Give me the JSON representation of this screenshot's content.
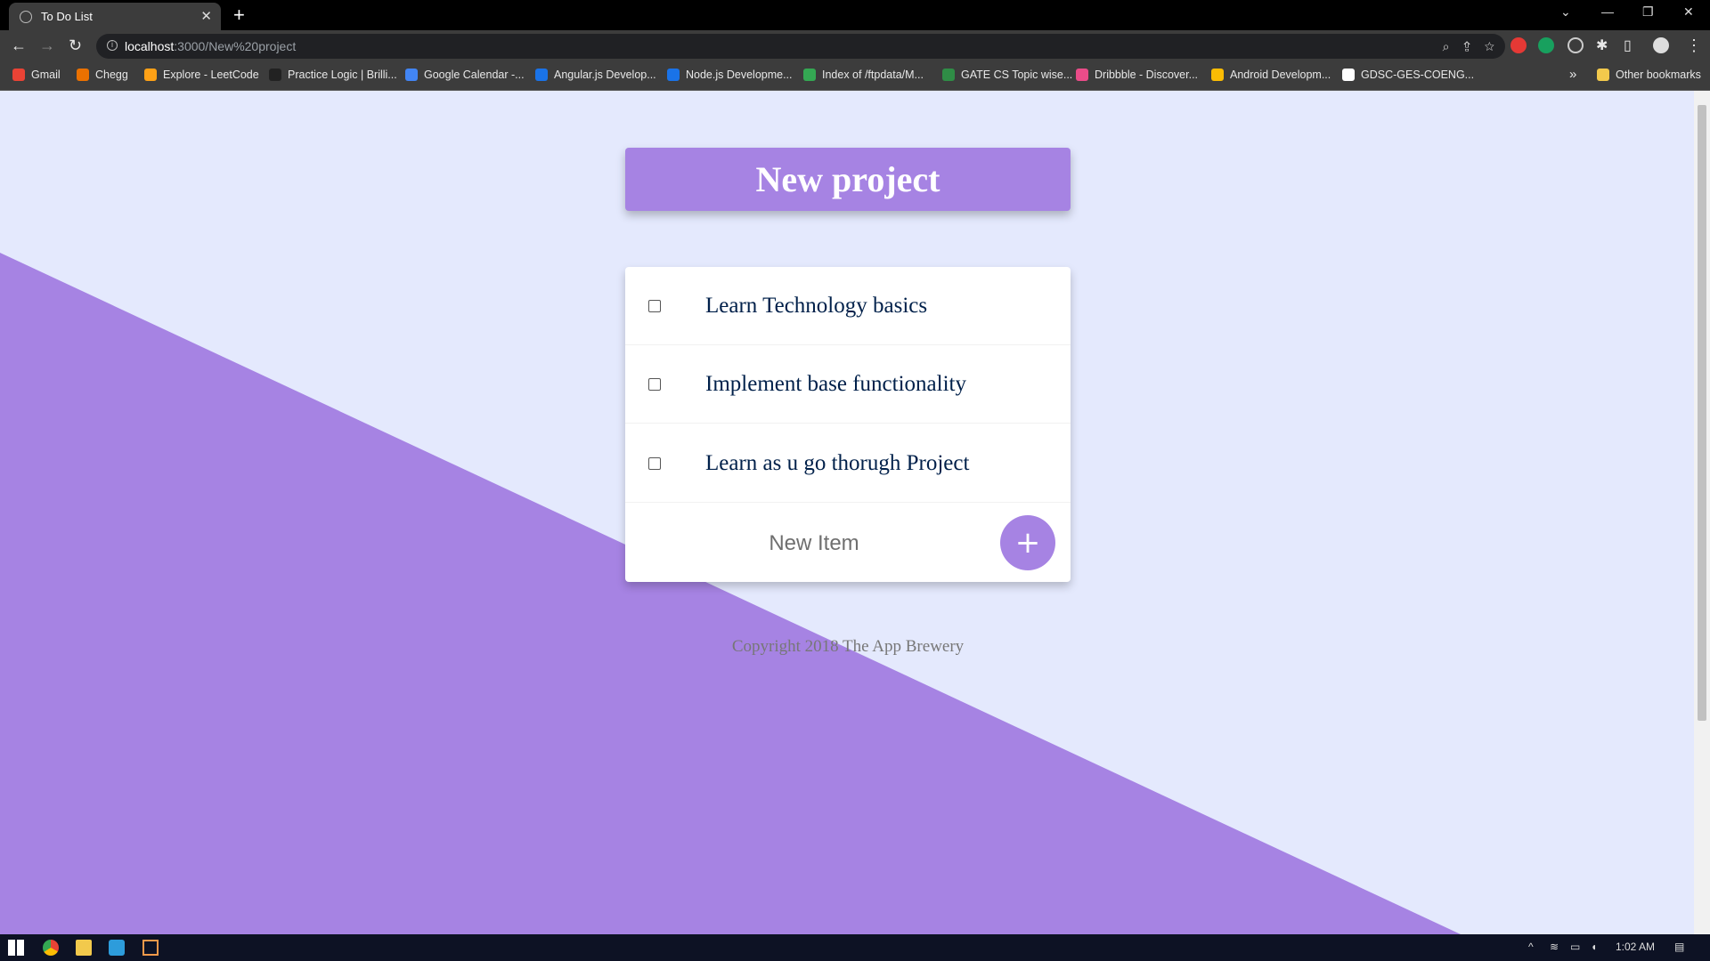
{
  "browser": {
    "tab_title": "To Do List",
    "new_tab_glyph": "+",
    "tab_close_glyph": "✕",
    "url_host": "localhost",
    "url_path": ":3000/New%20project",
    "bookmarks": [
      {
        "label": "Gmail",
        "color": "#ea4335"
      },
      {
        "label": "Chegg",
        "color": "#eb7100"
      },
      {
        "label": "Explore - LeetCode",
        "color": "#ffa116"
      },
      {
        "label": "Practice Logic | Brilli...",
        "color": "#222222"
      },
      {
        "label": "Google Calendar -...",
        "color": "#4285f4"
      },
      {
        "label": "Angular.js Develop...",
        "color": "#1a73e8"
      },
      {
        "label": "Node.js Developme...",
        "color": "#1a73e8"
      },
      {
        "label": "Index of /ftpdata/M...",
        "color": "#34a853"
      },
      {
        "label": "GATE CS Topic wise...",
        "color": "#2f8d46"
      },
      {
        "label": "Dribbble - Discover...",
        "color": "#ea4c89"
      },
      {
        "label": "Android Developm...",
        "color": "#fbbc04"
      },
      {
        "label": "GDSC-GES-COENG...",
        "color": "#ffffff"
      }
    ],
    "bookmarks_overflow": "»",
    "other_bookmarks": "Other bookmarks"
  },
  "app": {
    "title": "New project",
    "items": [
      {
        "text": "Learn Technology basics"
      },
      {
        "text": "Implement base functionality"
      },
      {
        "text": "Learn as u go thorugh Project"
      }
    ],
    "new_item_placeholder": "New Item",
    "add_button_label": "+",
    "footer": "Copyright 2018 The App Brewery",
    "accent_color": "#a683e3",
    "background_color": "#e4e9fd"
  },
  "taskbar": {
    "time": "1:02 AM"
  }
}
